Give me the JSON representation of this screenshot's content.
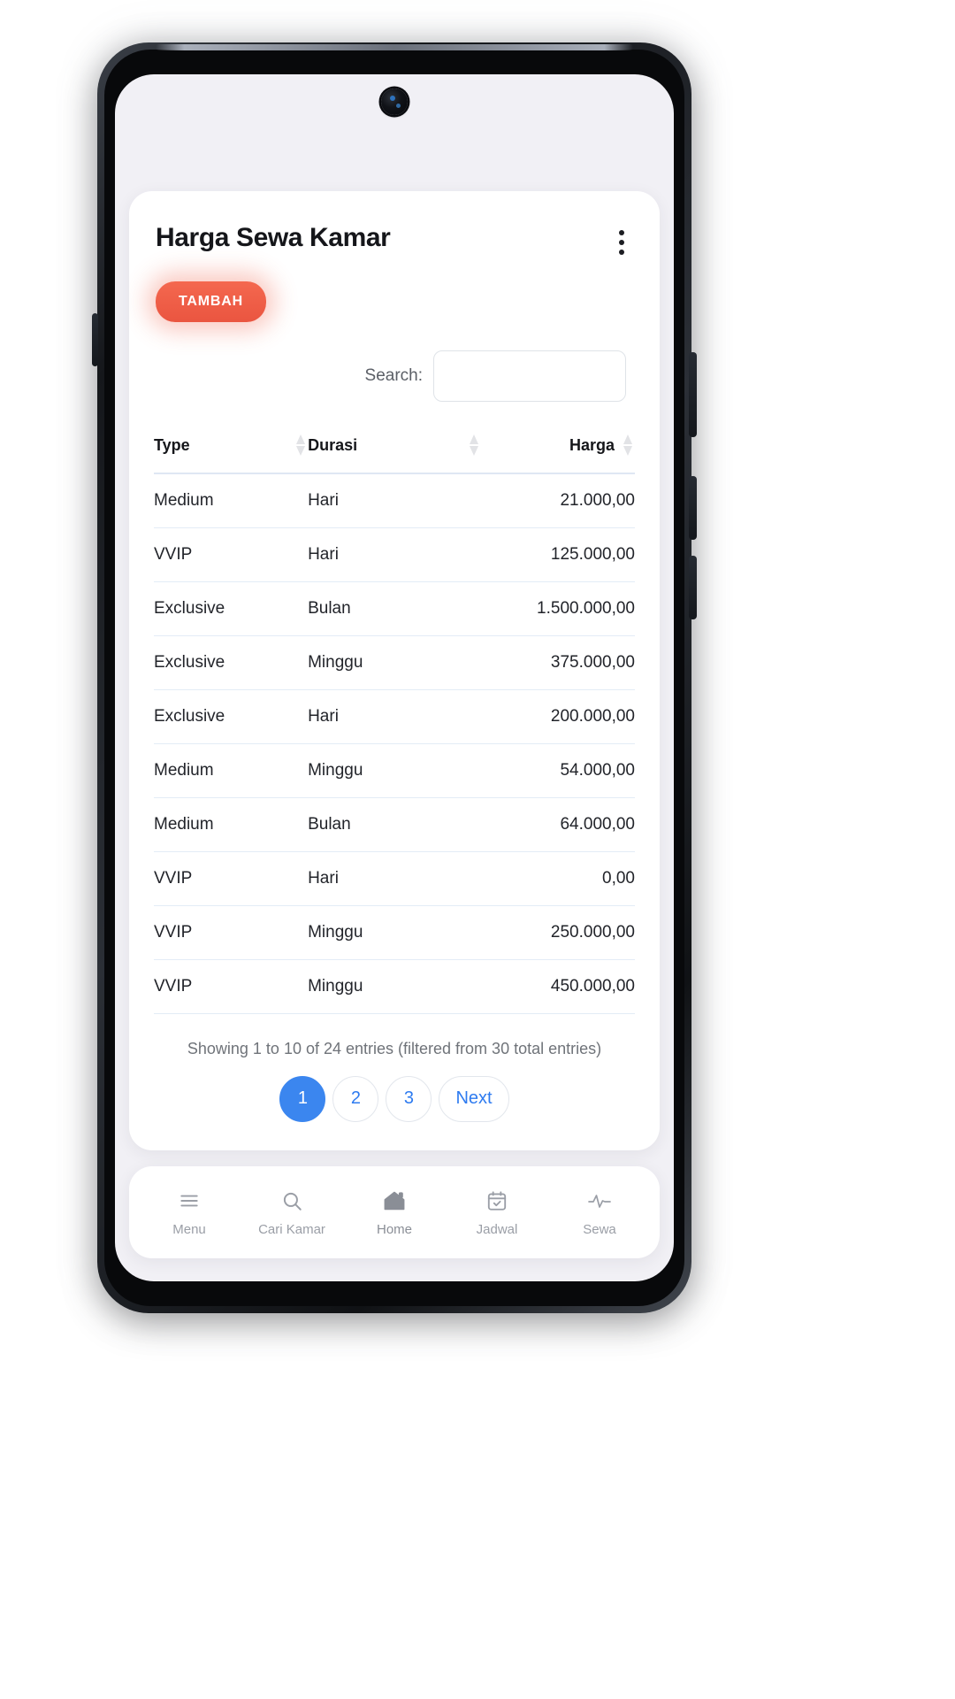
{
  "header": {
    "title": "Harga Sewa Kamar",
    "menu_icon": "kebab-menu-icon",
    "add_button_label": "TAMBAH",
    "accent_color": "#ee5a40"
  },
  "search": {
    "label": "Search:",
    "value": "",
    "placeholder": ""
  },
  "table": {
    "columns": [
      {
        "label": "Type",
        "sortable": true,
        "align": "left"
      },
      {
        "label": "Durasi",
        "sortable": true,
        "align": "left"
      },
      {
        "label": "Harga",
        "sortable": true,
        "align": "right"
      }
    ],
    "rows": [
      {
        "type": "Medium",
        "durasi": "Hari",
        "harga": "21.000,00"
      },
      {
        "type": "VVIP",
        "durasi": "Hari",
        "harga": "125.000,00"
      },
      {
        "type": "Exclusive",
        "durasi": "Bulan",
        "harga": "1.500.000,00"
      },
      {
        "type": "Exclusive",
        "durasi": "Minggu",
        "harga": "375.000,00"
      },
      {
        "type": "Exclusive",
        "durasi": "Hari",
        "harga": "200.000,00"
      },
      {
        "type": "Medium",
        "durasi": "Minggu",
        "harga": "54.000,00"
      },
      {
        "type": "Medium",
        "durasi": "Bulan",
        "harga": "64.000,00"
      },
      {
        "type": "VVIP",
        "durasi": "Hari",
        "harga": "0,00"
      },
      {
        "type": "VVIP",
        "durasi": "Minggu",
        "harga": "250.000,00"
      },
      {
        "type": "VVIP",
        "durasi": "Minggu",
        "harga": "450.000,00"
      }
    ]
  },
  "footer": {
    "info": "Showing 1 to 10 of 24 entries (filtered from 30 total entries)",
    "pagination": [
      {
        "label": "1",
        "active": true
      },
      {
        "label": "2",
        "active": false
      },
      {
        "label": "3",
        "active": false
      },
      {
        "label": "Next",
        "active": false
      }
    ],
    "link_color": "#2e7bf0",
    "active_color": "#3b86ef"
  },
  "bottom_nav": {
    "items": [
      {
        "label": "Menu",
        "icon": "hamburger-menu-icon",
        "active": false
      },
      {
        "label": "Cari Kamar",
        "icon": "search-icon",
        "active": false
      },
      {
        "label": "Home",
        "icon": "home-icon",
        "active": true
      },
      {
        "label": "Jadwal",
        "icon": "calendar-check-icon",
        "active": false
      },
      {
        "label": "Sewa",
        "icon": "activity-pulse-icon",
        "active": false
      }
    ]
  }
}
